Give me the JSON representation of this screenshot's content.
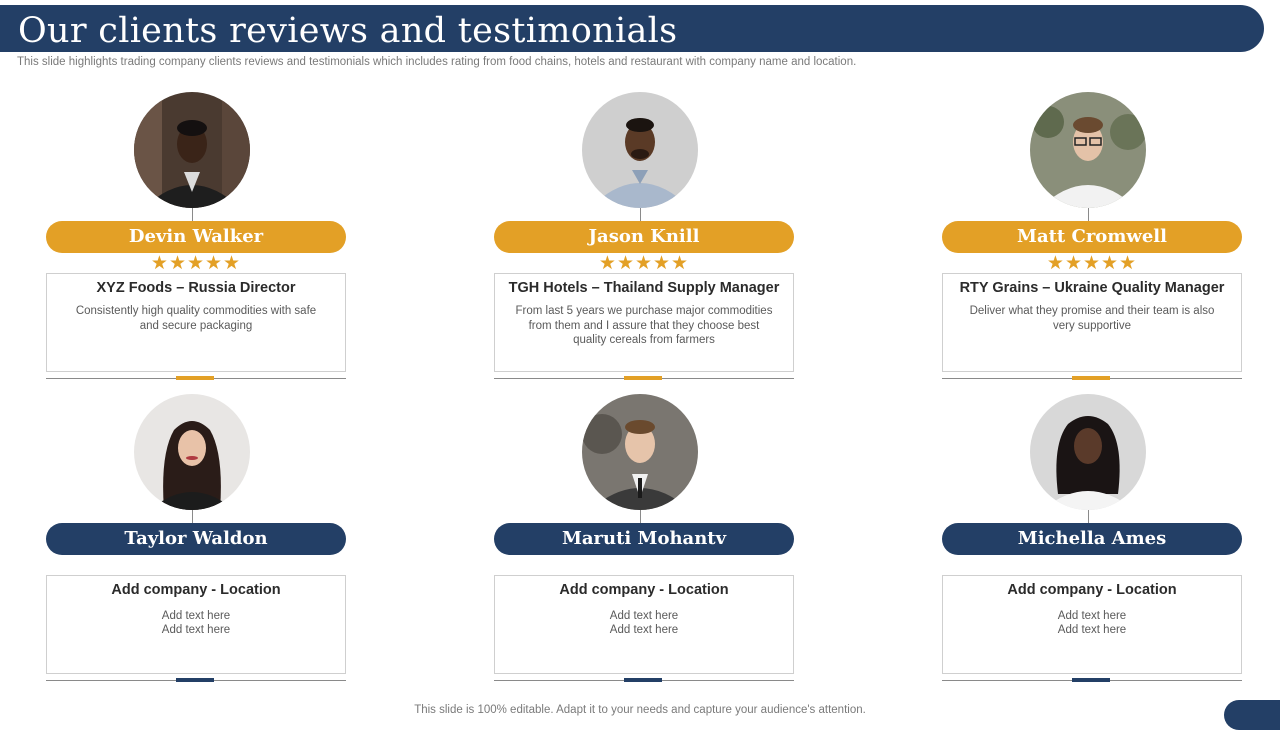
{
  "header": {
    "title": "Our clients reviews and testimonials",
    "subtitle": "This slide highlights trading company clients reviews and testimonials which includes rating from food chains, hotels and restaurant with company name and location."
  },
  "colors": {
    "navy": "#233f66",
    "gold": "#e3a026"
  },
  "testimonials": [
    {
      "name": "Devin Walker",
      "rating": 5,
      "stars": "★★★★★",
      "company": "XYZ Foods – Russia Director",
      "text": "Consistently high quality commodities with safe and secure packaging"
    },
    {
      "name": "Jason Knill",
      "rating": 5,
      "stars": "★★★★★",
      "company": "TGH Hotels – Thailand Supply Manager",
      "text": "From last 5 years we purchase major commodities from them and I assure that they choose best quality cereals from farmers"
    },
    {
      "name": "Matt Cromwell",
      "rating": 5,
      "stars": "★★★★★",
      "company": "RTY Grains – Ukraine Quality Manager",
      "text": "Deliver what they promise and their team is also very supportive"
    }
  ],
  "placeholders": [
    {
      "name": "Taylor Waldon",
      "company": "Add company  - Location",
      "line1": "Add text here",
      "line2": "Add text here"
    },
    {
      "name": "Maruti Mohantv",
      "company": "Add company  - Location",
      "line1": "Add text here",
      "line2": "Add text here"
    },
    {
      "name": "Michella Ames",
      "company": "Add company  - Location",
      "line1": "Add text here",
      "line2": "Add text here"
    }
  ],
  "footer": {
    "text": "This slide is 100% editable. Adapt it to your needs and capture your audience's attention."
  }
}
